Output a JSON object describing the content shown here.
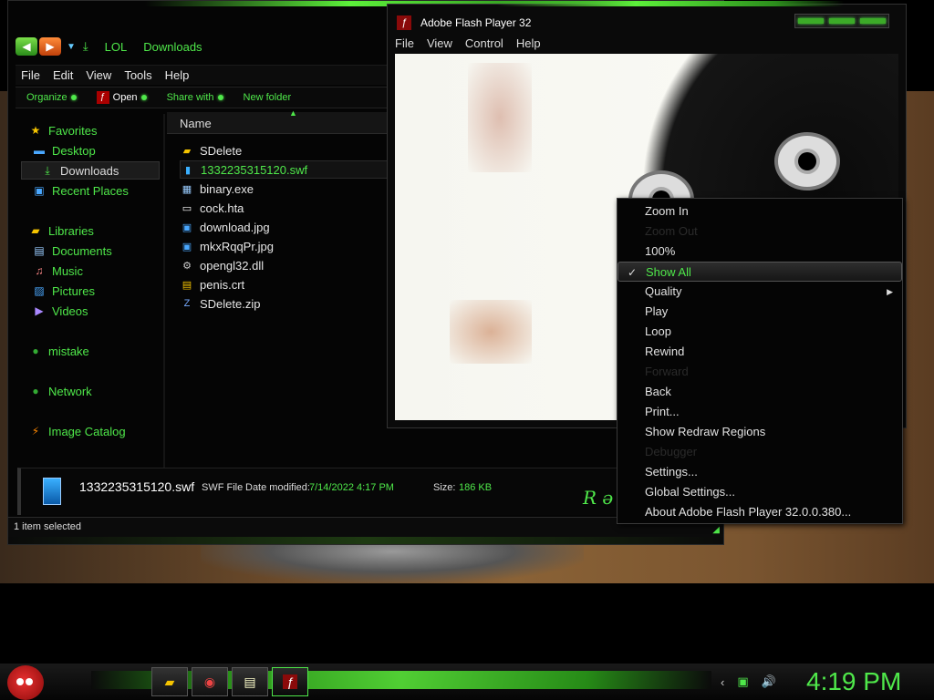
{
  "explorer": {
    "breadcrumb": [
      "LOL",
      "Downloads"
    ],
    "menu": [
      "File",
      "Edit",
      "View",
      "Tools",
      "Help"
    ],
    "commands": {
      "organize": "Organize",
      "open": "Open",
      "share": "Share with",
      "new_folder": "New folder"
    },
    "nav": {
      "favorites": "Favorites",
      "desktop": "Desktop",
      "downloads": "Downloads",
      "recent": "Recent Places",
      "libraries": "Libraries",
      "documents": "Documents",
      "music": "Music",
      "pictures": "Pictures",
      "videos": "Videos",
      "mistake": "mistake",
      "network": "Network",
      "image_catalog": "Image Catalog"
    },
    "column_name": "Name",
    "files": [
      "SDelete",
      "1332235315120.swf",
      "binary.exe",
      "cock.hta",
      "download.jpg",
      "mkxRqqPr.jpg",
      "opengl32.dll",
      "penis.crt",
      "SDelete.zip"
    ],
    "details": {
      "filename": "1332235315120.swf",
      "type": "SWF File",
      "date_label": "Date modified:",
      "date_value": "7/14/2022 4:17 PM",
      "size_label": "Size:",
      "size_value": "186 KB"
    },
    "status": "1 item selected"
  },
  "flash": {
    "title": "Adobe Flash Player 32",
    "menu": [
      "File",
      "View",
      "Control",
      "Help"
    ]
  },
  "context_menu": {
    "items": [
      "Zoom In",
      "Zoom Out",
      "100%",
      "Show All",
      "Quality",
      "Play",
      "Loop",
      "Rewind",
      "Forward",
      "Back",
      "Print...",
      "Show Redraw Regions",
      "Debugger",
      "Settings...",
      "Global Settings...",
      "About Adobe Flash Player 32.0.0.380..."
    ]
  },
  "taskbar": {
    "clock": "4:19 PM"
  },
  "colors": {
    "accent": "#4fe84a",
    "background": "#000000"
  }
}
